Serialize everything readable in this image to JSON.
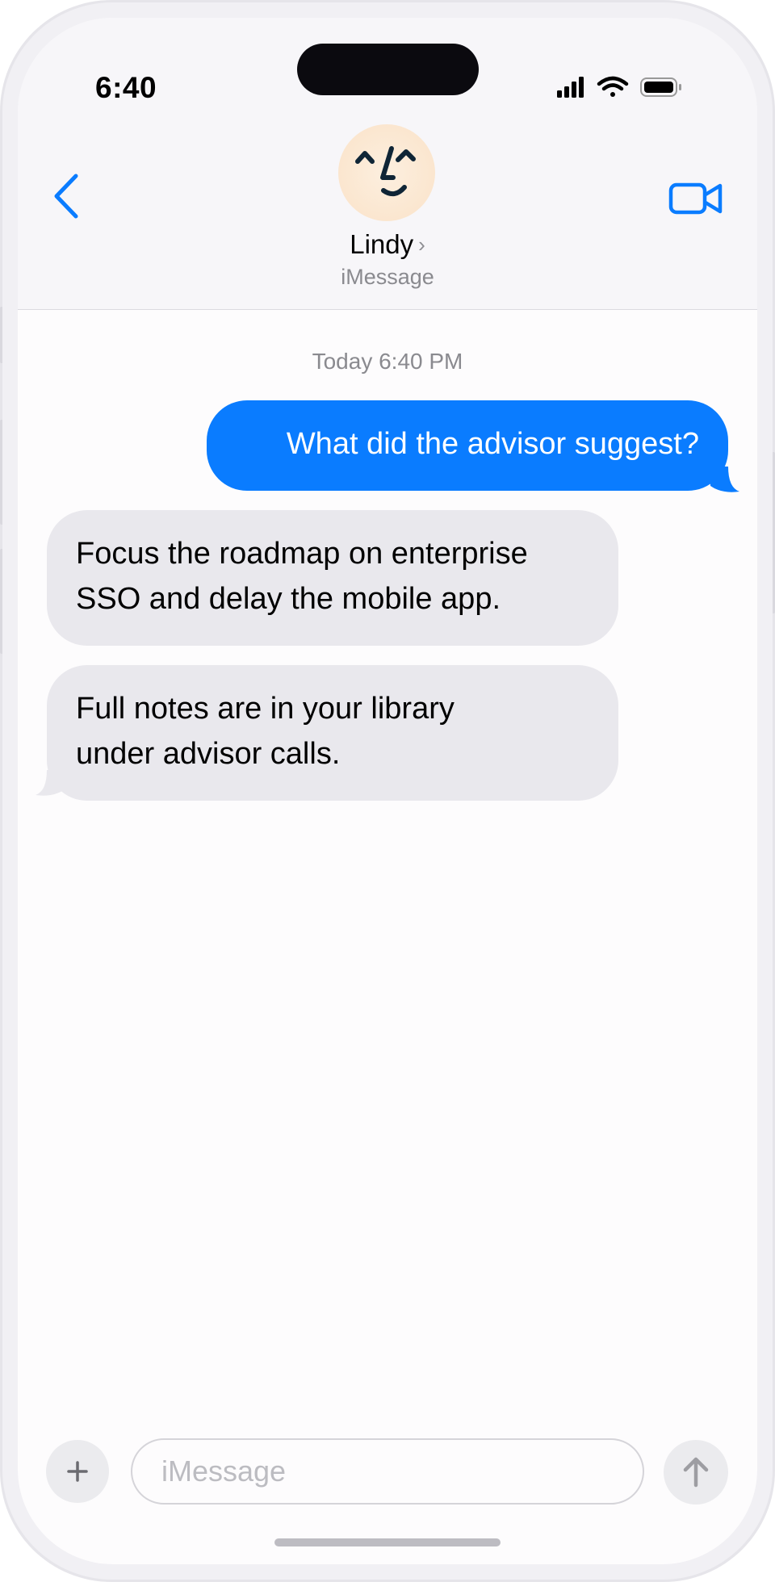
{
  "status_bar": {
    "time": "6:40",
    "icons": [
      "cellular-signal-icon",
      "wifi-icon",
      "battery-icon"
    ]
  },
  "header": {
    "back_icon": "chevron-left-icon",
    "video_icon": "video-camera-icon",
    "contact_name": "Lindy",
    "contact_chevron": "›",
    "contact_subtitle": "iMessage"
  },
  "conversation": {
    "timestamp": "Today 6:40 PM",
    "messages": [
      {
        "direction": "outgoing",
        "text": "What did the advisor suggest?"
      },
      {
        "direction": "incoming",
        "lines": [
          "Focus the roadmap on enterprise",
          "SSO and delay the mobile app."
        ]
      },
      {
        "direction": "incoming",
        "lines": [
          "Full notes are in your library",
          "under advisor calls."
        ]
      }
    ]
  },
  "composer": {
    "plus_label": "+",
    "input_placeholder": "iMessage",
    "input_value": "",
    "send_icon": "arrow-up-icon"
  },
  "colors": {
    "accent": "#0a7cff",
    "incoming_bubble": "#e9e8ed",
    "outgoing_bubble": "#0a7cff"
  }
}
